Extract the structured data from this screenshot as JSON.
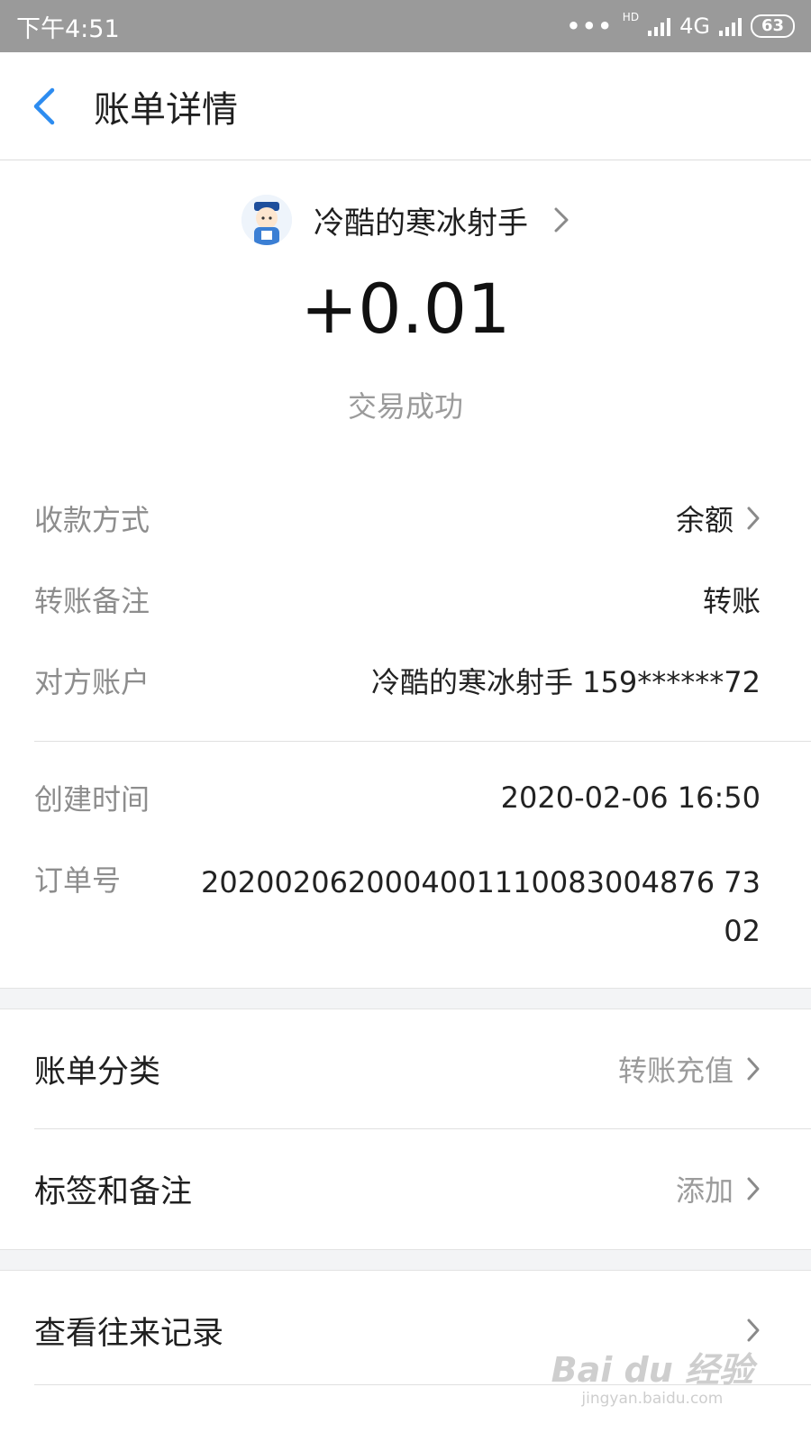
{
  "status_bar": {
    "time": "下午4:51",
    "network": "4G",
    "hd": "HD",
    "battery": "63"
  },
  "nav": {
    "title": "账单详情"
  },
  "transaction": {
    "counterparty_name": "冷酷的寒冰射手",
    "amount": "+0.01",
    "status": "交易成功"
  },
  "details": [
    {
      "label": "收款方式",
      "value": "余额"
    },
    {
      "label": "转账备注",
      "value": "转账"
    },
    {
      "label": "对方账户",
      "value": "冷酷的寒冰射手 159******72"
    },
    {
      "label": "创建时间",
      "value": "2020-02-06 16:50"
    },
    {
      "label": "订单号",
      "value": "2020020620004001110083004876 7302"
    }
  ],
  "actions": [
    {
      "label": "账单分类",
      "value": "转账充值"
    },
    {
      "label": "标签和备注",
      "value": "添加"
    },
    {
      "label": "查看往来记录",
      "value": ""
    }
  ],
  "watermark": {
    "logo": "Bai du 经验",
    "url": "jingyan.baidu.com"
  },
  "colors": {
    "accent": "#2d8cf0",
    "status_bar_bg": "#9a9a9a",
    "band_bg": "#f3f4f6"
  }
}
